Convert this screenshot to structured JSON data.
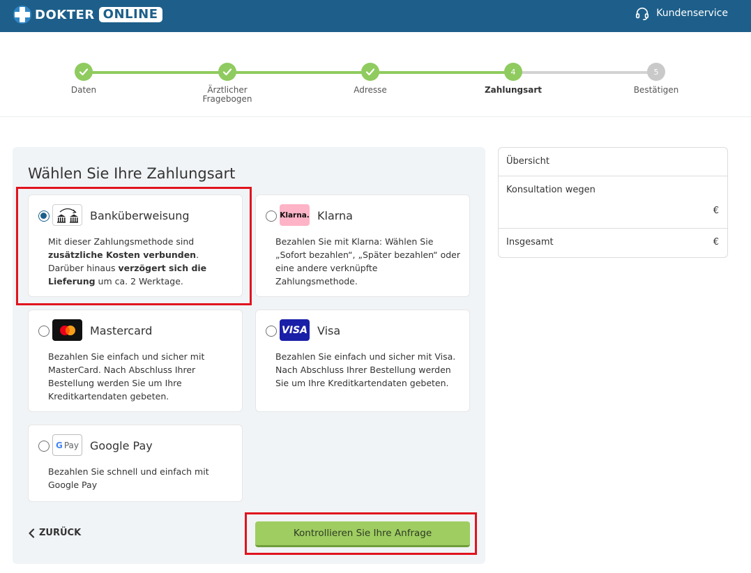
{
  "header": {
    "logo_part1": "DOKTER",
    "logo_part2": "ONLINE",
    "customer_service": "Kundenservice",
    "icons": {
      "customer_service": "headset-icon"
    }
  },
  "stepper": {
    "steps": [
      {
        "label": "Daten",
        "state": "done",
        "number": "1"
      },
      {
        "label": "Ärztlicher Fragebogen",
        "state": "done",
        "number": "2"
      },
      {
        "label": "Adresse",
        "state": "done",
        "number": "3"
      },
      {
        "label": "Zahlungsart",
        "state": "active",
        "number": "4"
      },
      {
        "label": "Bestätigen",
        "state": "todo",
        "number": "5"
      }
    ]
  },
  "payment": {
    "title": "Wählen Sie Ihre Zahlungsart",
    "methods": [
      {
        "name": "Banküberweisung",
        "icon": "bank-transfer-icon",
        "selected": true,
        "desc_parts": [
          "Mit dieser Zahlungsmethode sind ",
          "zusätzliche Kosten verbunden",
          ". Darüber hinaus ",
          "verzögert sich die Lieferung",
          " um ca. 2 Werktage."
        ]
      },
      {
        "name": "Klarna",
        "icon": "klarna-logo",
        "icon_text": "Klarna.",
        "selected": false,
        "desc": "Bezahlen Sie mit Klarna: Wählen Sie „Sofort bezahlen“, „Später bezahlen“ oder eine andere verknüpfte Zahlungsmethode."
      },
      {
        "name": "Mastercard",
        "icon": "mastercard-logo",
        "selected": false,
        "desc": "Bezahlen Sie einfach und sicher mit MasterCard. Nach Abschluss Ihrer Bestellung werden Sie um Ihre Kreditkartendaten gebeten."
      },
      {
        "name": "Visa",
        "icon": "visa-logo",
        "icon_text": "VISA",
        "selected": false,
        "desc": "Bezahlen Sie einfach und sicher mit Visa. Nach Abschluss Ihrer Bestellung werden Sie um Ihre Kreditkartendaten gebeten."
      },
      {
        "name": "Google Pay",
        "icon": "google-pay-logo",
        "icon_text": "Pay",
        "selected": false,
        "desc": "Bezahlen Sie schnell und einfach mit Google Pay"
      }
    ],
    "back_label": "ZURÜCK",
    "submit_label": "Kontrollieren Sie Ihre Anfrage"
  },
  "summary": {
    "title": "Übersicht",
    "consultation_label": "Konsultation wegen",
    "consultation_currency": "€",
    "total_label": "Insgesamt",
    "total_currency": "€"
  },
  "colors": {
    "header": "#1d5f8a",
    "progress_done": "#8fcb5f",
    "submit": "#9fcd62",
    "highlight": "#e0141e"
  }
}
